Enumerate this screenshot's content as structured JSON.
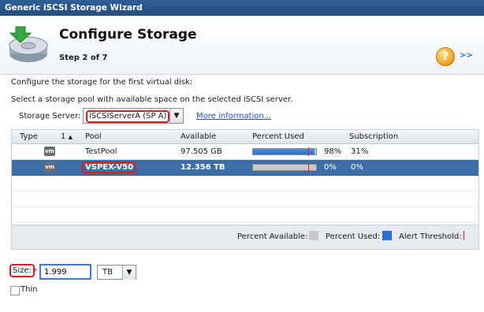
{
  "window": {
    "title": "Generic iSCSI Storage Wizard"
  },
  "header": {
    "title": "Configure Storage",
    "step": "Step 2 of 7",
    "help_glyph": "?",
    "more_glyph": ">>"
  },
  "instructions": {
    "line1": "Configure the storage for the first virtual disk:",
    "line2": "Select a storage pool with available space on the selected iSCSI server."
  },
  "server": {
    "label": "Storage Server:",
    "selected": "iSCSIServerA (SP A)",
    "more_info": "More information..."
  },
  "table": {
    "columns": {
      "type": "Type",
      "num": "1",
      "pool": "Pool",
      "available": "Available",
      "percent_used": "Percent Used",
      "subscription": "Subscription"
    },
    "sort_indicator": "▲",
    "rows": [
      {
        "type_icon": "vm",
        "pool": "TestPool",
        "available": "97.505 GB",
        "percent_used": 98,
        "percent_label": "98%",
        "subscription": "31%",
        "selected": false
      },
      {
        "type_icon": "vm",
        "pool": "VSPEX-V50",
        "available": "12.356 TB",
        "percent_used": 0,
        "percent_label": "0%",
        "subscription": "0%",
        "selected": true
      }
    ]
  },
  "legend": {
    "available": "Percent Available:",
    "used": "Percent Used:",
    "threshold": "Alert Threshold:"
  },
  "size": {
    "label": "Size:",
    "value": "1.999",
    "unit": "TB",
    "thin_label": "Thin",
    "thin_checked": false
  },
  "colors": {
    "selection": "#3d6fa6",
    "used": "#2a6fd2",
    "available": "#c8c8c8",
    "threshold": "#d0212a",
    "highlight": "#d0212a"
  }
}
